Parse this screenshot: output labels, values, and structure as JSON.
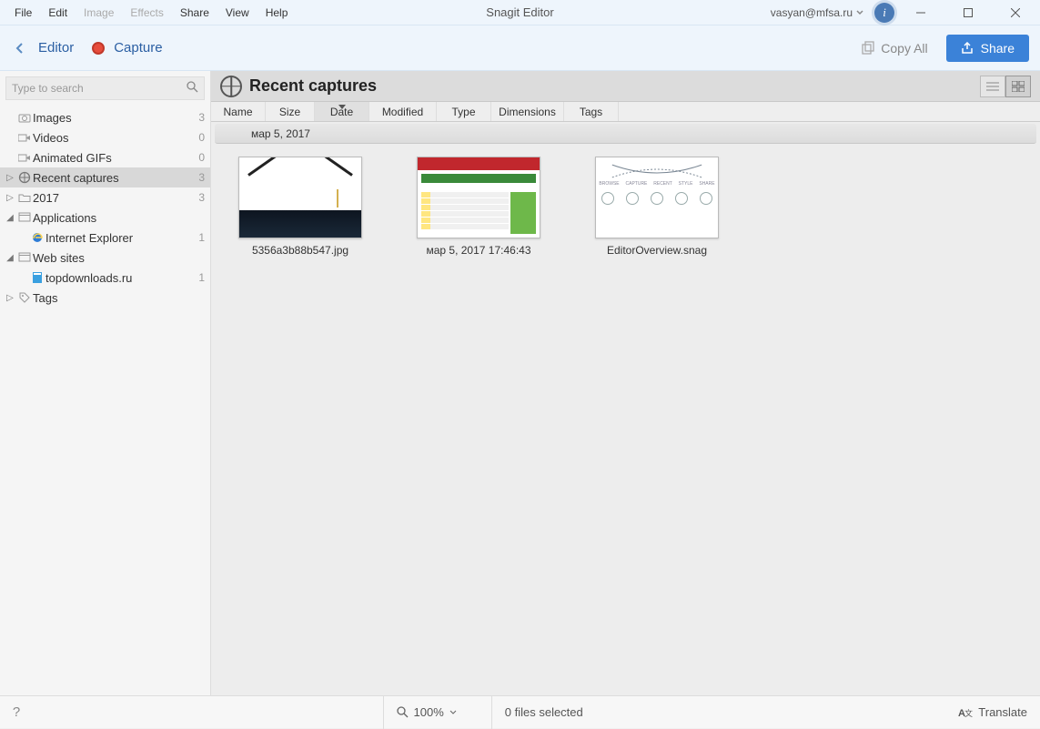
{
  "app_title": "Snagit Editor",
  "user_email": "vasyan@mfsa.ru",
  "menu": [
    "File",
    "Edit",
    "Image",
    "Effects",
    "Share",
    "View",
    "Help"
  ],
  "menu_disabled": [
    "Image",
    "Effects"
  ],
  "toolbar": {
    "editor_label": "Editor",
    "capture_label": "Capture",
    "copy_all": "Copy All",
    "share": "Share"
  },
  "search_placeholder": "Type to search",
  "tree": [
    {
      "depth": 0,
      "icon": "camera",
      "label": "Images",
      "count": "3",
      "expand": ""
    },
    {
      "depth": 0,
      "icon": "video",
      "label": "Videos",
      "count": "0",
      "expand": ""
    },
    {
      "depth": 0,
      "icon": "video",
      "label": "Animated GIFs",
      "count": "0",
      "expand": ""
    },
    {
      "depth": 0,
      "icon": "globe",
      "label": "Recent captures",
      "count": "3",
      "expand": "▷",
      "selected": true
    },
    {
      "depth": 0,
      "icon": "folder",
      "label": "2017",
      "count": "3",
      "expand": "▷"
    },
    {
      "depth": 0,
      "icon": "app",
      "label": "Applications",
      "count": "",
      "expand": "◢"
    },
    {
      "depth": 1,
      "icon": "ie",
      "label": "Internet Explorer",
      "count": "1",
      "expand": ""
    },
    {
      "depth": 0,
      "icon": "app",
      "label": "Web sites",
      "count": "",
      "expand": "◢"
    },
    {
      "depth": 1,
      "icon": "site",
      "label": "topdownloads.ru",
      "count": "1",
      "expand": ""
    },
    {
      "depth": 0,
      "icon": "tag",
      "label": "Tags",
      "count": "",
      "expand": "▷"
    }
  ],
  "main_title": "Recent captures",
  "columns": [
    "Name",
    "Size",
    "Date",
    "Modified",
    "Type",
    "Dimensions",
    "Tags"
  ],
  "sorted_column": "Date",
  "date_group": "мар 5, 2017",
  "thumbnails": [
    {
      "caption": "5356a3b88b547.jpg",
      "kind": "t1"
    },
    {
      "caption": "мар 5, 2017 17:46:43",
      "kind": "t2"
    },
    {
      "caption": "EditorOverview.snag",
      "kind": "t3"
    }
  ],
  "statusbar": {
    "zoom": "100%",
    "selection": "0 files selected",
    "translate": "Translate"
  }
}
